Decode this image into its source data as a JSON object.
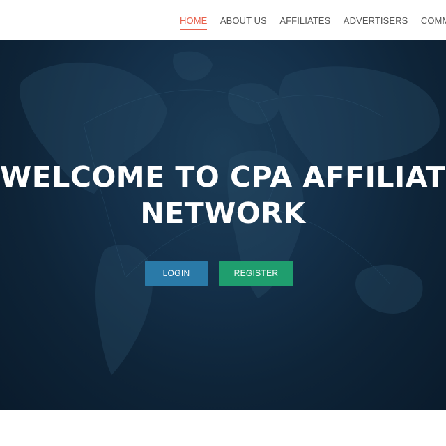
{
  "nav": {
    "items": [
      {
        "label": "HOME",
        "active": true
      },
      {
        "label": "ABOUT US",
        "active": false
      },
      {
        "label": "AFFILIATES",
        "active": false
      },
      {
        "label": "ADVERTISERS",
        "active": false
      },
      {
        "label": "COMMISSIONS",
        "active": false
      }
    ],
    "active_color": "#e8604c"
  },
  "hero": {
    "title_line1": "WELCOME TO CPA AFFILIATE",
    "title_line2": "NETWORK",
    "background_icon": "world-map",
    "login_label": "LOGIN",
    "register_label": "REGISTER",
    "login_color": "#2a7aa8",
    "register_color": "#1f9e6e"
  }
}
